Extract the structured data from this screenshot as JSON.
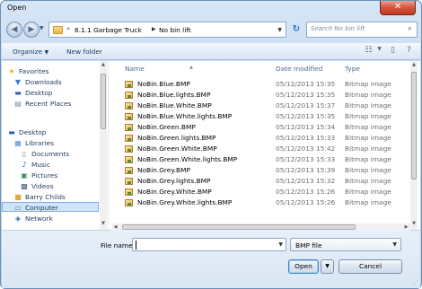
{
  "window": {
    "title": "Open"
  },
  "address": {
    "segments": [
      "6.1.1 Garbage Truck",
      "No bin lift"
    ],
    "prefix": "«"
  },
  "search": {
    "placeholder": "Search No bin lift"
  },
  "toolbar": {
    "organize_label": "Organize",
    "new_folder_label": "New folder"
  },
  "nav_pane": {
    "items": [
      {
        "label": "Favorites",
        "icon": "star-icon"
      },
      {
        "label": "Downloads",
        "icon": "download-folder-icon"
      },
      {
        "label": "Desktop",
        "icon": "desktop-icon"
      },
      {
        "label": "Recent Places",
        "icon": "recent-places-icon"
      },
      {
        "label": "Desktop",
        "icon": "desktop-icon"
      },
      {
        "label": "Libraries",
        "icon": "libraries-icon"
      },
      {
        "label": "Documents",
        "icon": "documents-icon"
      },
      {
        "label": "Music",
        "icon": "music-icon"
      },
      {
        "label": "Pictures",
        "icon": "pictures-icon"
      },
      {
        "label": "Videos",
        "icon": "videos-icon"
      },
      {
        "label": "Barry Childs",
        "icon": "user-folder-icon"
      },
      {
        "label": "Computer",
        "icon": "computer-icon"
      },
      {
        "label": "Network",
        "icon": "network-icon"
      }
    ]
  },
  "columns": {
    "name": "Name",
    "date_modified": "Date modified",
    "type": "Type"
  },
  "files": [
    {
      "name": "NoBin.Blue.BMP",
      "date": "05/12/2013 15:35",
      "type": "Bitmap image"
    },
    {
      "name": "NoBin.Blue.lights.BMP",
      "date": "05/12/2013 15:35",
      "type": "Bitmap image"
    },
    {
      "name": "NoBin.Blue.White.BMP",
      "date": "05/12/2013 15:37",
      "type": "Bitmap image"
    },
    {
      "name": "NoBin.Blue.White.lights.BMP",
      "date": "05/12/2013 15:35",
      "type": "Bitmap image"
    },
    {
      "name": "NoBin.Green.BMP",
      "date": "05/12/2013 15:34",
      "type": "Bitmap image"
    },
    {
      "name": "NoBin.Green.lights.BMP",
      "date": "05/12/2013 15:33",
      "type": "Bitmap image"
    },
    {
      "name": "NoBin.Green.White.BMP",
      "date": "05/12/2013 15:42",
      "type": "Bitmap image"
    },
    {
      "name": "NoBin.Green.White.lights.BMP",
      "date": "05/12/2013 15:33",
      "type": "Bitmap image"
    },
    {
      "name": "NoBin.Grey.BMP",
      "date": "05/12/2013 15:39",
      "type": "Bitmap image"
    },
    {
      "name": "NoBin.Grey.lights.BMP",
      "date": "05/12/2013 15:32",
      "type": "Bitmap image"
    },
    {
      "name": "NoBin.Grey.White.BMP",
      "date": "05/12/2013 15:26",
      "type": "Bitmap image"
    },
    {
      "name": "NoBin.Grey.White.lights.BMP",
      "date": "05/12/2013 15:26",
      "type": "Bitmap image"
    }
  ],
  "file_name": {
    "label": "File name:",
    "value": ""
  },
  "file_type": {
    "selected": "BMP file"
  },
  "buttons": {
    "open": "Open",
    "cancel": "Cancel"
  }
}
